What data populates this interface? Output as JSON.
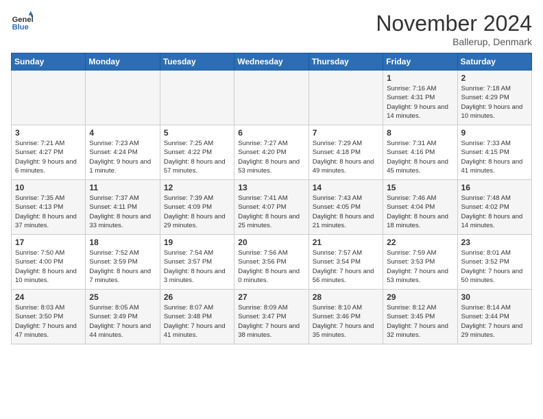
{
  "header": {
    "logo_line1": "General",
    "logo_line2": "Blue",
    "title": "November 2024",
    "subtitle": "Ballerup, Denmark"
  },
  "weekdays": [
    "Sunday",
    "Monday",
    "Tuesday",
    "Wednesday",
    "Thursday",
    "Friday",
    "Saturday"
  ],
  "weeks": [
    [
      {
        "day": "",
        "info": ""
      },
      {
        "day": "",
        "info": ""
      },
      {
        "day": "",
        "info": ""
      },
      {
        "day": "",
        "info": ""
      },
      {
        "day": "",
        "info": ""
      },
      {
        "day": "1",
        "info": "Sunrise: 7:16 AM\nSunset: 4:31 PM\nDaylight: 9 hours and 14 minutes."
      },
      {
        "day": "2",
        "info": "Sunrise: 7:18 AM\nSunset: 4:29 PM\nDaylight: 9 hours and 10 minutes."
      }
    ],
    [
      {
        "day": "3",
        "info": "Sunrise: 7:21 AM\nSunset: 4:27 PM\nDaylight: 9 hours and 6 minutes."
      },
      {
        "day": "4",
        "info": "Sunrise: 7:23 AM\nSunset: 4:24 PM\nDaylight: 9 hours and 1 minute."
      },
      {
        "day": "5",
        "info": "Sunrise: 7:25 AM\nSunset: 4:22 PM\nDaylight: 8 hours and 57 minutes."
      },
      {
        "day": "6",
        "info": "Sunrise: 7:27 AM\nSunset: 4:20 PM\nDaylight: 8 hours and 53 minutes."
      },
      {
        "day": "7",
        "info": "Sunrise: 7:29 AM\nSunset: 4:18 PM\nDaylight: 8 hours and 49 minutes."
      },
      {
        "day": "8",
        "info": "Sunrise: 7:31 AM\nSunset: 4:16 PM\nDaylight: 8 hours and 45 minutes."
      },
      {
        "day": "9",
        "info": "Sunrise: 7:33 AM\nSunset: 4:15 PM\nDaylight: 8 hours and 41 minutes."
      }
    ],
    [
      {
        "day": "10",
        "info": "Sunrise: 7:35 AM\nSunset: 4:13 PM\nDaylight: 8 hours and 37 minutes."
      },
      {
        "day": "11",
        "info": "Sunrise: 7:37 AM\nSunset: 4:11 PM\nDaylight: 8 hours and 33 minutes."
      },
      {
        "day": "12",
        "info": "Sunrise: 7:39 AM\nSunset: 4:09 PM\nDaylight: 8 hours and 29 minutes."
      },
      {
        "day": "13",
        "info": "Sunrise: 7:41 AM\nSunset: 4:07 PM\nDaylight: 8 hours and 25 minutes."
      },
      {
        "day": "14",
        "info": "Sunrise: 7:43 AM\nSunset: 4:05 PM\nDaylight: 8 hours and 21 minutes."
      },
      {
        "day": "15",
        "info": "Sunrise: 7:46 AM\nSunset: 4:04 PM\nDaylight: 8 hours and 18 minutes."
      },
      {
        "day": "16",
        "info": "Sunrise: 7:48 AM\nSunset: 4:02 PM\nDaylight: 8 hours and 14 minutes."
      }
    ],
    [
      {
        "day": "17",
        "info": "Sunrise: 7:50 AM\nSunset: 4:00 PM\nDaylight: 8 hours and 10 minutes."
      },
      {
        "day": "18",
        "info": "Sunrise: 7:52 AM\nSunset: 3:59 PM\nDaylight: 8 hours and 7 minutes."
      },
      {
        "day": "19",
        "info": "Sunrise: 7:54 AM\nSunset: 3:57 PM\nDaylight: 8 hours and 3 minutes."
      },
      {
        "day": "20",
        "info": "Sunrise: 7:56 AM\nSunset: 3:56 PM\nDaylight: 8 hours and 0 minutes."
      },
      {
        "day": "21",
        "info": "Sunrise: 7:57 AM\nSunset: 3:54 PM\nDaylight: 7 hours and 56 minutes."
      },
      {
        "day": "22",
        "info": "Sunrise: 7:59 AM\nSunset: 3:53 PM\nDaylight: 7 hours and 53 minutes."
      },
      {
        "day": "23",
        "info": "Sunrise: 8:01 AM\nSunset: 3:52 PM\nDaylight: 7 hours and 50 minutes."
      }
    ],
    [
      {
        "day": "24",
        "info": "Sunrise: 8:03 AM\nSunset: 3:50 PM\nDaylight: 7 hours and 47 minutes."
      },
      {
        "day": "25",
        "info": "Sunrise: 8:05 AM\nSunset: 3:49 PM\nDaylight: 7 hours and 44 minutes."
      },
      {
        "day": "26",
        "info": "Sunrise: 8:07 AM\nSunset: 3:48 PM\nDaylight: 7 hours and 41 minutes."
      },
      {
        "day": "27",
        "info": "Sunrise: 8:09 AM\nSunset: 3:47 PM\nDaylight: 7 hours and 38 minutes."
      },
      {
        "day": "28",
        "info": "Sunrise: 8:10 AM\nSunset: 3:46 PM\nDaylight: 7 hours and 35 minutes."
      },
      {
        "day": "29",
        "info": "Sunrise: 8:12 AM\nSunset: 3:45 PM\nDaylight: 7 hours and 32 minutes."
      },
      {
        "day": "30",
        "info": "Sunrise: 8:14 AM\nSunset: 3:44 PM\nDaylight: 7 hours and 29 minutes."
      }
    ]
  ]
}
